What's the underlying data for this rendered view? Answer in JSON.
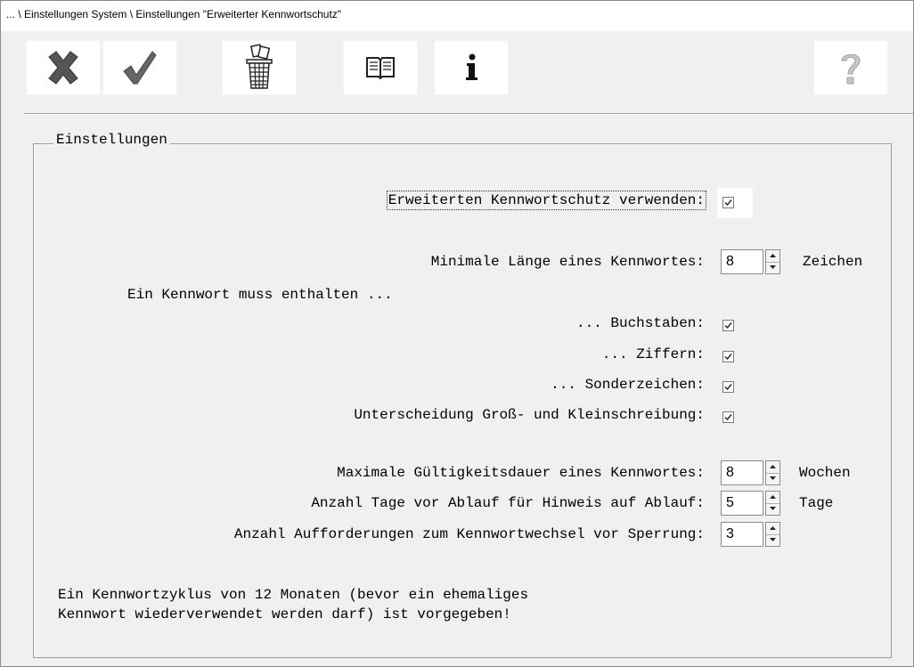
{
  "window": {
    "title": "... \\ Einstellungen System \\ Einstellungen \"Erweiterter Kennwortschutz\""
  },
  "toolbar": {
    "buttons": [
      {
        "icon": "cancel-x-icon"
      },
      {
        "icon": "checkmark-icon"
      },
      {
        "icon": "trash-bin-icon"
      },
      {
        "icon": "book-icon"
      },
      {
        "icon": "info-icon"
      },
      {
        "icon": "help-question-icon"
      }
    ]
  },
  "group": {
    "title": "Einstellungen",
    "use_extended": {
      "label": "Erweiterten Kennwortschutz verwenden:",
      "checked": true
    },
    "min_length": {
      "label": "Minimale Länge eines Kennwortes:",
      "value": "8",
      "unit": "Zeichen"
    },
    "must_contain": {
      "label": "Ein Kennwort muss enthalten ..."
    },
    "letters": {
      "label": "... Buchstaben:",
      "checked": true
    },
    "digits": {
      "label": "... Ziffern:",
      "checked": true
    },
    "special": {
      "label": "... Sonderzeichen:",
      "checked": true
    },
    "case_sensitive": {
      "label": "Unterscheidung Groß- und Kleinschreibung:",
      "checked": true
    },
    "max_validity": {
      "label": "Maximale Gültigkeitsdauer eines Kennwortes:",
      "value": "8",
      "unit": "Wochen"
    },
    "days_warning": {
      "label": "Anzahl Tage vor Ablauf für Hinweis auf Ablauf:",
      "value": "5",
      "unit": "Tage"
    },
    "change_requests": {
      "label": "Anzahl Aufforderungen zum Kennwortwechsel vor Sperrung:",
      "value": "3"
    },
    "note_line1": "Ein Kennwortzyklus von 12 Monaten (bevor ein ehemaliges",
    "note_line2": "Kennwort wiederverwendet werden darf) ist vorgegeben!"
  },
  "colors": {
    "background": "#f0f0f0",
    "border": "#9a9a9a",
    "icon_gray": "#5a5a5a"
  }
}
